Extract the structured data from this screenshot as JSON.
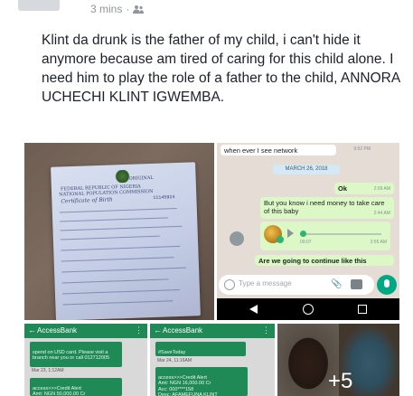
{
  "post": {
    "timestamp": "3 mins",
    "separator": "·",
    "audience_icon": "friends-icon",
    "text": "Klint da drunk is the father of my child, i can't hide it anymore because am tired of caring for this child alone. I need him to play the role of a father to the child, ANNORA UCHECHI KLINT IGWEMBA."
  },
  "certificate_photo": {
    "header": "FEDERAL REPUBLIC OF NIGERIA",
    "commission": "NATIONAL POPULATION COMMISSION",
    "title": "Certificate of Birth",
    "label": "ORIGINAL",
    "serial": "11145924"
  },
  "chat_photo": {
    "top_message": "when ever I see network",
    "top_time": "9:52 PM",
    "date": "MARCH 26, 2018",
    "ok_message": "Ok",
    "ok_time": "2:09 AM",
    "money_message": "But you know i need money to take care of this baby",
    "money_time": "2:44 AM",
    "voice_duration": "00:07",
    "voice_time": "2:55 AM",
    "continue_message": "Are we going to continue like this",
    "input_placeholder": "Type a message"
  },
  "bank_photo_1": {
    "title": "AccessBank",
    "message_1": "spend on USD card. Please visit a branch near you or call 012712005",
    "message_1_meta": "Mar 23, 1:12AM",
    "message_2": "access>>>Credit Alert\nAmt: NGN 50,000.00 Cr"
  },
  "bank_photo_2": {
    "title": "AccessBank",
    "message_1": "#SaveToday",
    "message_1_meta": "Mar 24, 11:16AM",
    "message_2": "access>>>Credit Alert\nAmt: NGN 16,000.00 Cr\nAcc: 000****158\nDesc: AFAMEFUNA KLINT"
  },
  "more_photos": {
    "count_label": "+5"
  }
}
